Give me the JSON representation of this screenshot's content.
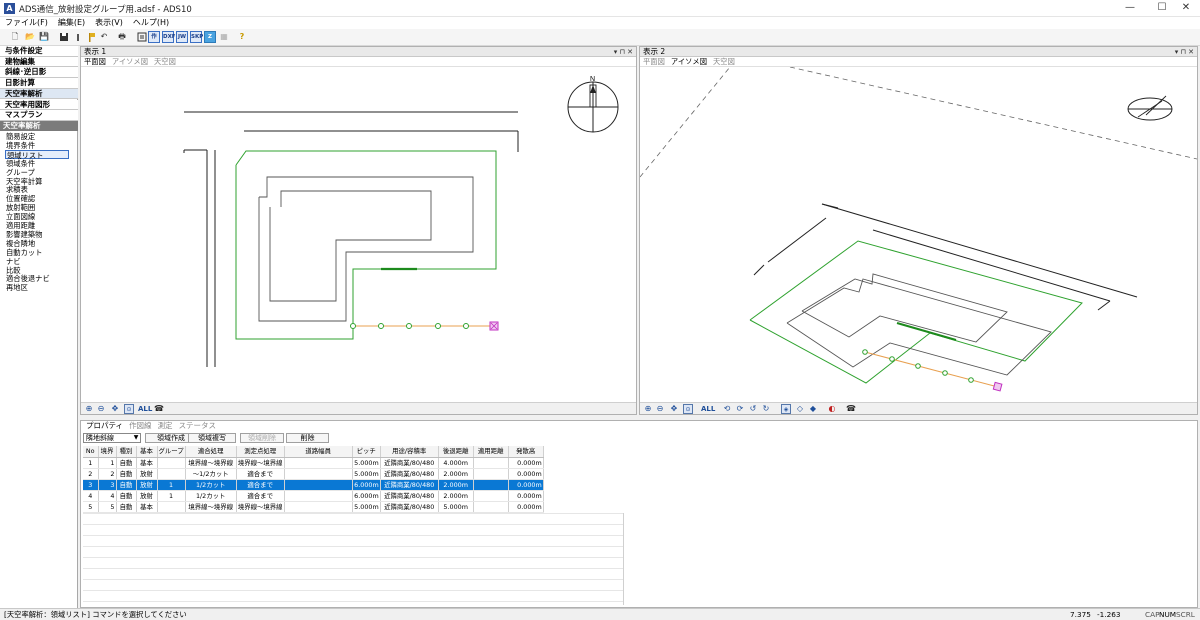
{
  "window": {
    "title": "ADS通信_放射設定グループ用.adsf - ADS10",
    "app_icon": "A",
    "minimize": "—",
    "maximize": "☐",
    "close": "✕"
  },
  "menu": [
    "ファイル(F)",
    "編集(E)",
    "表示(V)",
    "ヘルプ(H)"
  ],
  "toolbar": {
    "btn_new": "🗋",
    "btn_open": "📂",
    "btn_save": "💾",
    "btn_print": "🖶",
    "box_saku": "作",
    "box_dxf": "DXF",
    "box_jww": "JW",
    "box_skp": "SKP",
    "box_z": "Z",
    "help": "?"
  },
  "sidebar": {
    "sections": [
      "与条件設定",
      "建物編集",
      "斜線･逆日影",
      "日影計算",
      "天空率解析",
      "天空率用図形",
      "マスプラン"
    ],
    "selected_section": 4,
    "category": "天空率解析",
    "items": [
      "簡易設定",
      "境界条件",
      "領域リスト",
      "領域条件",
      "グループ",
      "天空率計算",
      "求積表",
      "位置確認",
      "放射範囲",
      "立面図線",
      "適用距離",
      "影響建築物",
      "複合隣地",
      "自動カット",
      "ナビ",
      "比較",
      "適合後退ナビ",
      "再地区"
    ],
    "selected_item": 2
  },
  "view1": {
    "title": "表示 1",
    "ctrls": "▾ ⊓ ✕",
    "tabs": [
      "平面図",
      "アイソメ図",
      "天空図"
    ],
    "active_tab": 0,
    "footer_all": "ALL"
  },
  "view2": {
    "title": "表示 2",
    "ctrls": "▾ ⊓ ✕",
    "tabs": [
      "平面図",
      "アイソメ図",
      "天空図"
    ],
    "active_tab": 1,
    "footer_all": "ALL"
  },
  "compass_north": "N",
  "props": {
    "tabs": [
      "プロパティ",
      "作図線",
      "測定",
      "ステータス"
    ],
    "active_tab": 0,
    "combo_value": "隣地斜線",
    "buttons": [
      "領域作成",
      "領域複写",
      "領域削除",
      "削除"
    ],
    "columns": [
      "No",
      "境界",
      "種別",
      "基本",
      "グループ",
      "適合処理",
      "測定点処理",
      "道路幅員",
      "ピッチ",
      "用途/容積率",
      "後退距離",
      "適用距離",
      "発散高"
    ],
    "rows": [
      [
        "1",
        "1",
        "自動",
        "基本",
        "",
        "境界線〜境界線",
        "境界線〜境界線",
        "",
        "5.000m",
        "近隣商業/80/480",
        "4.000m",
        "",
        "0.000m"
      ],
      [
        "2",
        "2",
        "自動",
        "放射",
        "",
        "〜1/2カット",
        "適合まで",
        "",
        "5.000m",
        "近隣商業/80/480",
        "2.000m",
        "",
        "0.000m"
      ],
      [
        "3",
        "3",
        "自動",
        "放射",
        "1",
        "1/2カット",
        "適合まで",
        "",
        "6.000m",
        "近隣商業/80/480",
        "2.000m",
        "",
        "0.000m"
      ],
      [
        "4",
        "4",
        "自動",
        "放射",
        "1",
        "1/2カット",
        "適合まで",
        "",
        "6.000m",
        "近隣商業/80/480",
        "2.000m",
        "",
        "0.000m"
      ],
      [
        "5",
        "5",
        "自動",
        "基本",
        "",
        "境界線〜境界線",
        "境界線〜境界線",
        "",
        "5.000m",
        "近隣商業/80/480",
        "5.000m",
        "",
        "0.000m"
      ]
    ],
    "selected_row": 2
  },
  "status": {
    "message": "[天空率解析：領域リスト] コマンドを選択してください",
    "coord_x": "7.375",
    "coord_y": "-1.263",
    "cap": "CAP",
    "num": "NUM",
    "scrl": "SCRL"
  },
  "colors": {
    "accent": "#0a78d4",
    "boundary_green": "#2fa22f",
    "building_gray": "#555555",
    "ray_orange": "#e8a050",
    "endpoint_magenta": "#c030c0"
  }
}
